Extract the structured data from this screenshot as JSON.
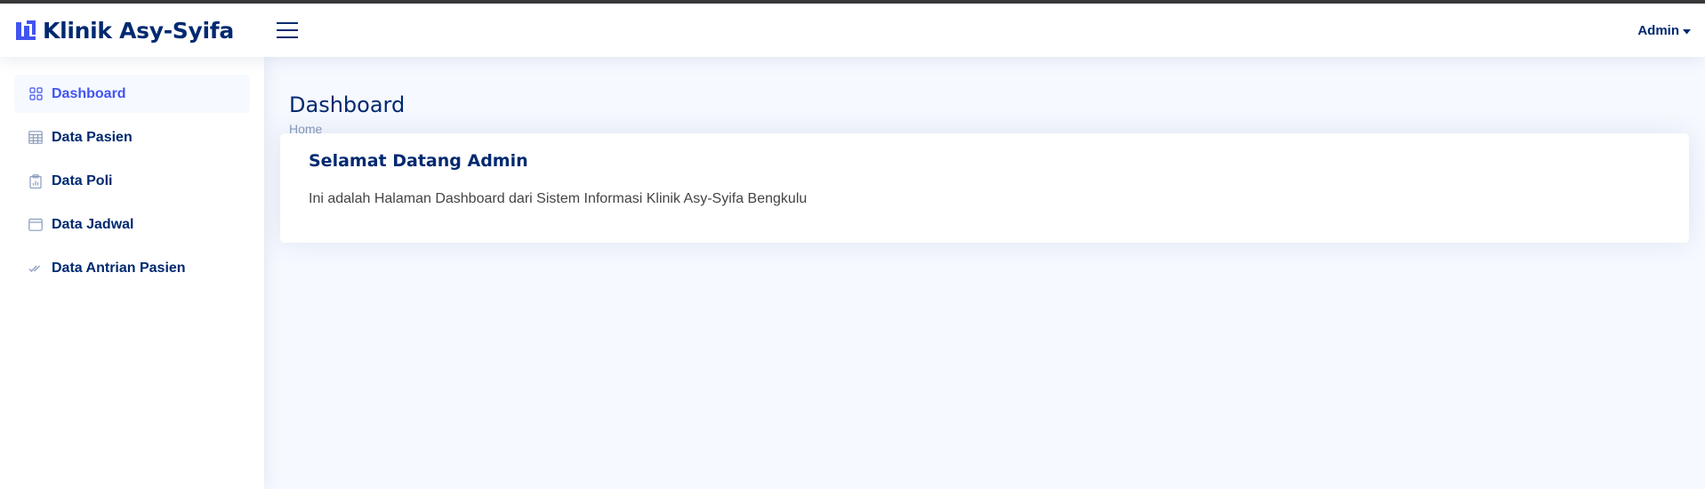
{
  "colors": {
    "brand": "#012970",
    "accent": "#4154f1",
    "background": "#f6f9ff",
    "muted": "#899bbd"
  },
  "header": {
    "app_name": "Klinik Asy-Syifa",
    "logo_icon": "brand-logo-icon",
    "menu_icon": "hamburger-menu-icon",
    "user_label": "Admin",
    "user_icon": "caret-down-icon"
  },
  "sidebar": {
    "items": [
      {
        "label": "Dashboard",
        "icon": "grid-icon",
        "active": true
      },
      {
        "label": "Data Pasien",
        "icon": "table-icon",
        "active": false
      },
      {
        "label": "Data Poli",
        "icon": "clipboard-data-icon",
        "active": false
      },
      {
        "label": "Data Jadwal",
        "icon": "calendar-icon",
        "active": false
      },
      {
        "label": "Data Antrian Pasien",
        "icon": "check-all-icon",
        "active": false
      }
    ]
  },
  "main": {
    "page_title": "Dashboard",
    "breadcrumb": "Home",
    "card": {
      "greeting": "Selamat Datang",
      "user": "Admin",
      "text": "Ini adalah Halaman Dashboard dari Sistem Informasi Klinik Asy-Syifa Bengkulu"
    }
  }
}
